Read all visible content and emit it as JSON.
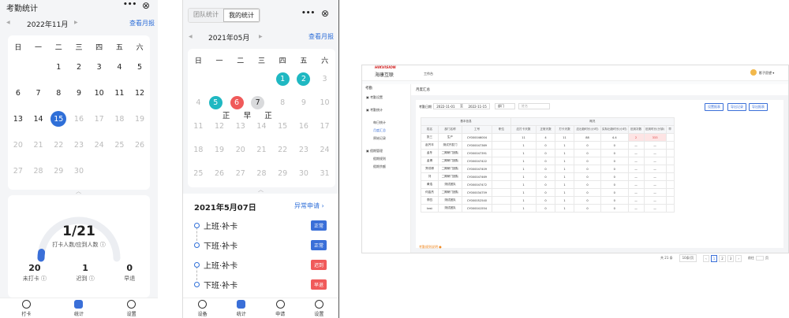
{
  "p1": {
    "title": "考勤统计",
    "more": "•••",
    "close": "⊗",
    "month": "2022年11月",
    "prev": "◀",
    "next": "▶",
    "report_link": "查看月报",
    "weekdays": [
      "日",
      "一",
      "二",
      "三",
      "四",
      "五",
      "六"
    ],
    "weeks": [
      [
        "",
        "",
        "1",
        "2",
        "3",
        "4",
        "5"
      ],
      [
        "6",
        "7",
        "8",
        "9",
        "10",
        "11",
        "12"
      ],
      [
        "13",
        "14",
        "15",
        "16",
        "17",
        "18",
        "19"
      ],
      [
        "20",
        "21",
        "22",
        "23",
        "24",
        "25",
        "26"
      ],
      [
        "27",
        "28",
        "29",
        "30",
        "",
        "",
        ""
      ]
    ],
    "today": "15",
    "ratio": "1/21",
    "ratio_label": "打卡人数/应到人数",
    "stats": [
      {
        "value": "20",
        "label": "未打卡"
      },
      {
        "value": "1",
        "label": "迟到"
      },
      {
        "value": "0",
        "label": "早退"
      }
    ],
    "nav": [
      "打卡",
      "统计",
      "设置"
    ],
    "nav_active": 1,
    "colors": {
      "accent": "#2f6fd8",
      "progress": "#3a6fd8"
    },
    "progress_fraction": 0.05
  },
  "p2": {
    "tabs": [
      "团队统计",
      "我的统计"
    ],
    "active_tab": 1,
    "more": "•••",
    "close": "⊗",
    "month": "2021年05月",
    "prev": "◀",
    "next": "▶",
    "report_link": "查看月报",
    "weekdays": [
      "日",
      "一",
      "二",
      "三",
      "四",
      "五",
      "六"
    ],
    "weeks": [
      [
        "",
        "",
        "",
        "",
        "1",
        "2",
        "3"
      ],
      [
        "4",
        "5",
        "6",
        "7",
        "8",
        "9",
        "10"
      ],
      [
        "11",
        "12",
        "13",
        "14",
        "15",
        "16",
        "17"
      ],
      [
        "18",
        "19",
        "20",
        "21",
        "22",
        "23",
        "24"
      ],
      [
        "25",
        "26",
        "27",
        "28",
        "29",
        "30",
        "31"
      ]
    ],
    "marks": {
      "1": "teal",
      "2": "teal",
      "5": "teal",
      "6": "red",
      "7": "grey"
    },
    "mark_labels": {
      "5": "正",
      "6": "早",
      "7": "正"
    },
    "date_title": "2021年5月07日",
    "abnormal_link": "异常申请",
    "timeline": [
      {
        "label": "上班·补卡",
        "status": "正常",
        "color": "#3a6fd8"
      },
      {
        "label": "下班·补卡",
        "status": "正常",
        "color": "#3a6fd8"
      },
      {
        "label": "上班·补卡",
        "status": "迟到",
        "color": "#f05a5a"
      },
      {
        "label": "下班·补卡",
        "status": "早退",
        "color": "#f05a5a"
      }
    ],
    "nav": [
      "设备",
      "统计",
      "申请",
      "设置"
    ],
    "nav_active": 1,
    "colors": {
      "teal": "#1fb8c2",
      "red": "#f05a5a",
      "grey": "#d9dadc"
    }
  },
  "p3": {
    "brand": "HIKVISION",
    "brand_cn": "海康互联",
    "workbench": "工作台",
    "user": "影子愿望",
    "side_title": "考勤",
    "side_items": [
      "考勤设置",
      "考勤统计",
      "每日统计",
      "月度汇总",
      "原始记录",
      "假期管理",
      "假期规则",
      "假期余额"
    ],
    "page_title": "月度汇总",
    "filter_date_label": "考勤日期",
    "date_from": "2022-11-01",
    "date_to": "2022-11-15",
    "dept": "部门",
    "search_placeholder": "姓名",
    "buttons": [
      "设置报表",
      "导出记录",
      "导出报表"
    ],
    "group_basic": "基本信息",
    "group_summary": "概况",
    "columns": [
      "姓名",
      "部门名称",
      "工号",
      "职位",
      "应打卡天数",
      "正常天数",
      "打卡天数",
      "应出勤时长(小时)",
      "实际出勤时长(小时)",
      "迟到次数",
      "迟到时长(分钟)",
      "早"
    ],
    "rows": [
      [
        "张三",
        "生产",
        "CY000046004",
        "",
        "11",
        "4",
        "11",
        "88",
        "4.4",
        "2",
        "333",
        ""
      ],
      [
        "赵齐丰",
        "测试开发门",
        "CY000047369",
        "",
        "1",
        "0",
        "1",
        "0",
        "0",
        "—",
        "—",
        ""
      ],
      [
        "孟冬",
        "二期研门团队",
        "CY000047391",
        "",
        "1",
        "0",
        "1",
        "0",
        "0",
        "—",
        "—",
        ""
      ],
      [
        "孟博",
        "二期研门团队",
        "CY000047422",
        "",
        "1",
        "0",
        "1",
        "0",
        "0",
        "—",
        "—",
        ""
      ],
      [
        "郑洪博",
        "二期研门团队",
        "CY000047409",
        "",
        "1",
        "0",
        "1",
        "0",
        "0",
        "—",
        "—",
        ""
      ],
      [
        "刘",
        "二期研门团队",
        "CY000047469",
        "",
        "1",
        "0",
        "1",
        "0",
        "0",
        "—",
        "—",
        ""
      ],
      [
        "黄浩",
        "测试团队",
        "CY000047472",
        "",
        "1",
        "0",
        "1",
        "0",
        "0",
        "—",
        "—",
        ""
      ],
      [
        "何金杰",
        "二期研门团队",
        "CY000034759",
        "",
        "1",
        "0",
        "1",
        "0",
        "0",
        "—",
        "—",
        ""
      ],
      [
        "李四",
        "测试团队",
        "CY000052540",
        "",
        "1",
        "0",
        "1",
        "0",
        "0",
        "—",
        "—",
        ""
      ],
      [
        "test",
        "测试团队",
        "CY000041554",
        "",
        "1",
        "0",
        "1",
        "0",
        "0",
        "—",
        "—",
        ""
      ]
    ],
    "footer_note": "考勤规则说明",
    "total": "共 21 条",
    "per_page": "10条/页",
    "pages": [
      "1",
      "2",
      "3"
    ],
    "goto": "前往",
    "page_suffix": "页"
  }
}
